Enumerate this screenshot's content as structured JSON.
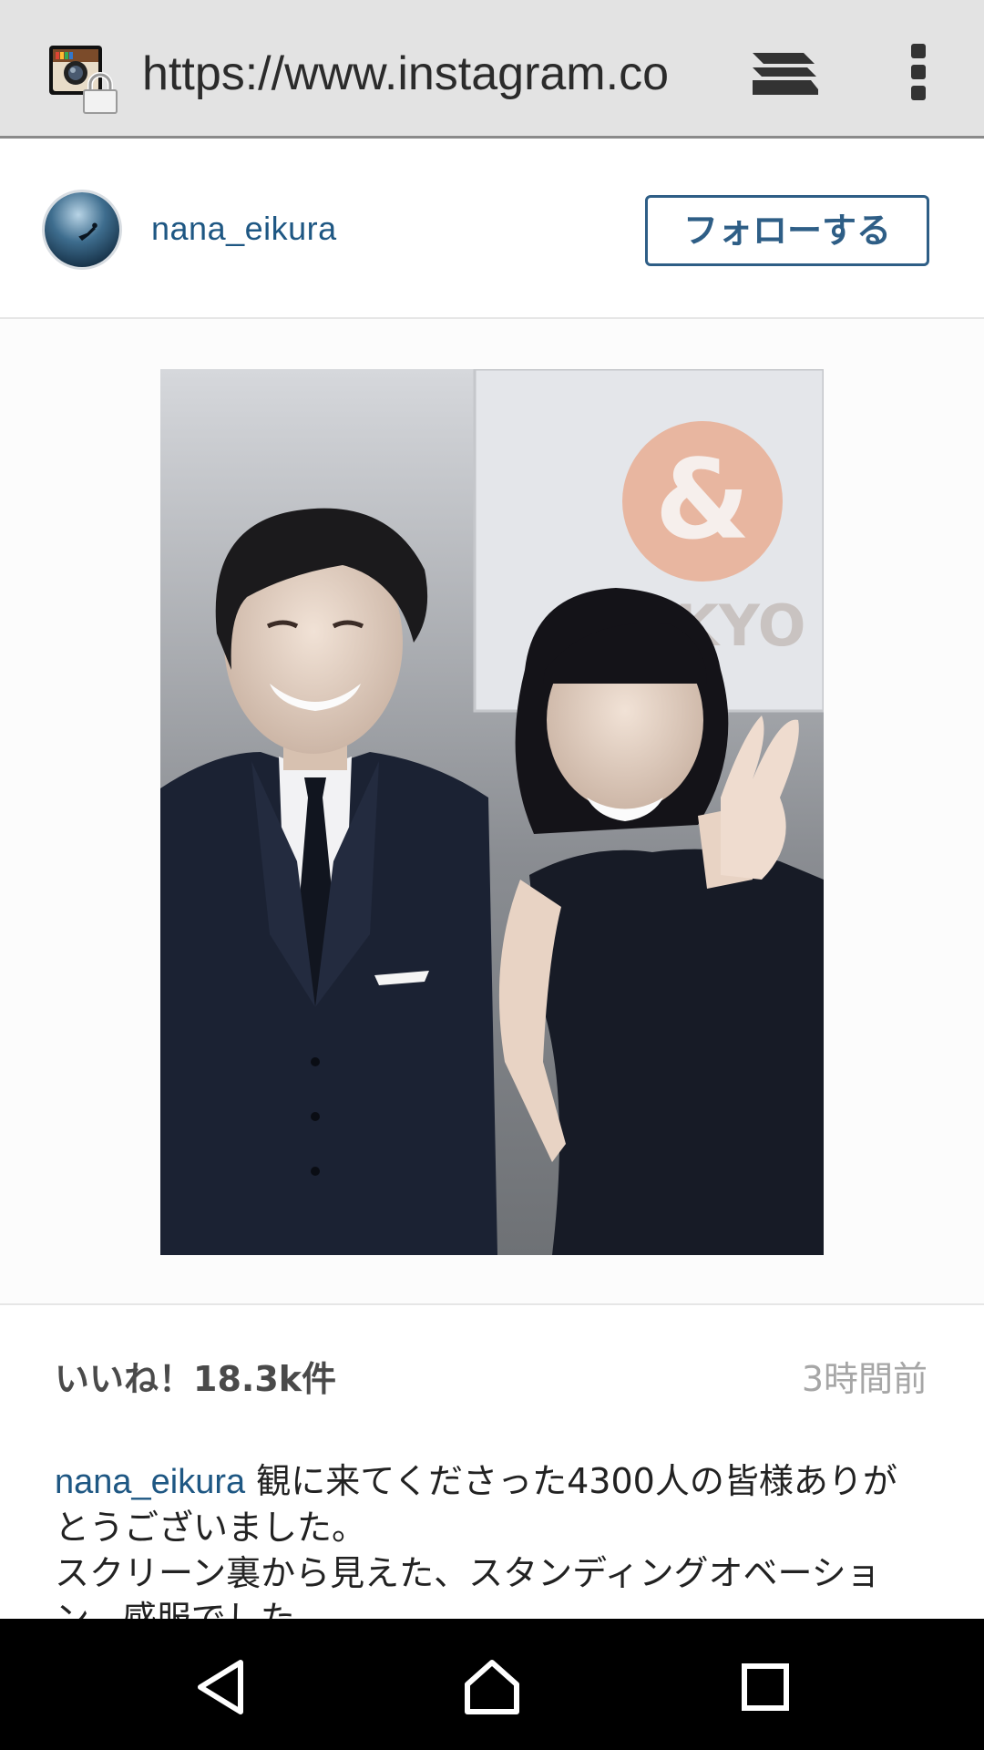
{
  "browser": {
    "url": "https://www.instagram.co",
    "site_icon": "instagram-icon",
    "secure_icon": "lock-icon",
    "tabs_icon": "tabs-icon",
    "menu_icon": "overflow-menu-icon"
  },
  "post": {
    "username": "nana_eikura",
    "follow_label": "フォローする",
    "photo_sign_text": "TOKYO",
    "likes_text": "いいね！18.3k件",
    "time_text": "3時間前",
    "caption_user": "nana_eikura",
    "caption_text": " 観に来てくださった4300人の皆様ありがとうございました。\nスクリーン裏から見えた、スタンディングオベーション、感服でした。"
  },
  "colors": {
    "toolbar_bg": "#e3e3e3",
    "link_blue": "#1e5783",
    "follow_border": "#2e5e86",
    "navbar_bg": "#000000"
  },
  "navbar": {
    "back_icon": "back-icon",
    "home_icon": "home-icon",
    "recents_icon": "recents-icon"
  }
}
